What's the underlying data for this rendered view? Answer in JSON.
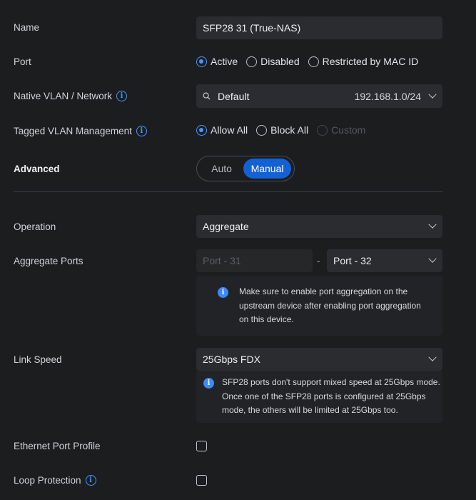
{
  "name": {
    "label": "Name",
    "value": "SFP28 31 (True-NAS)"
  },
  "port": {
    "label": "Port",
    "options": [
      "Active",
      "Disabled",
      "Restricted by MAC ID"
    ],
    "selected": "Active"
  },
  "native_vlan": {
    "label": "Native VLAN / Network",
    "value": "Default",
    "subnet": "192.168.1.0/24"
  },
  "tagged_vlan": {
    "label": "Tagged VLAN Management",
    "options": [
      "Allow All",
      "Block All",
      "Custom"
    ],
    "selected": "Allow All"
  },
  "advanced": {
    "label": "Advanced",
    "options": [
      "Auto",
      "Manual"
    ],
    "selected": "Manual"
  },
  "operation": {
    "label": "Operation",
    "value": "Aggregate"
  },
  "aggregate_ports": {
    "label": "Aggregate Ports",
    "from": "Port - 31",
    "separator": "-",
    "to": "Port - 32",
    "note_lines": [
      "Make sure to enable port aggregation on the",
      "upstream device after enabling port aggregation",
      "on this device."
    ]
  },
  "link_speed": {
    "label": "Link Speed",
    "value": "25Gbps FDX",
    "note_lines": [
      "SFP28 ports don't support mixed speed at 25Gbps mode.",
      "Once one of the SFP28 ports is configured at 25Gbps",
      "mode, the others will be limited at 25Gbps too."
    ]
  },
  "ethernet_port_profile": {
    "label": "Ethernet Port Profile",
    "checked": false
  },
  "loop_protection": {
    "label": "Loop Protection",
    "checked": false
  },
  "colors": {
    "accent": "#1461d6",
    "info": "#4797ff",
    "background": "#1c1d1f",
    "field": "#2b2c2f"
  },
  "icons": {
    "info": "info-icon",
    "search": "search-icon",
    "dropdown": "chevron-down-icon"
  }
}
